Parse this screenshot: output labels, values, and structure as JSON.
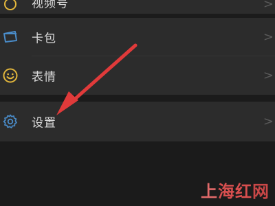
{
  "menu": {
    "items": [
      {
        "label": "视频号",
        "icon": "video-channel-icon"
      },
      {
        "label": "卡包",
        "icon": "card-wallet-icon"
      },
      {
        "label": "表情",
        "icon": "emoji-icon"
      },
      {
        "label": "设置",
        "icon": "gear-icon"
      }
    ],
    "chevron": ">"
  },
  "colors": {
    "background": "#1b1b1b",
    "row_background": "#2c2c2c",
    "text": "#dcdcdc",
    "card_icon": "#4a8cc9",
    "emoji_icon": "#e3b73c",
    "gear_icon": "#4a8cc9",
    "arrow": "#e03a3a"
  },
  "watermark": {
    "c1": "上",
    "c2": "海",
    "c3": "红",
    "c4": "网"
  }
}
